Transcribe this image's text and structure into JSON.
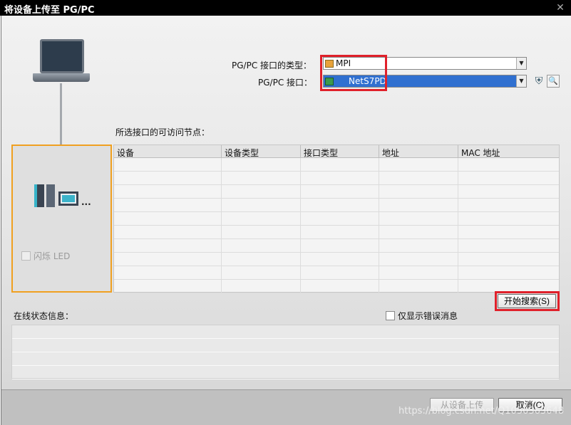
{
  "window": {
    "title": "将设备上传至 PG/PC"
  },
  "interface": {
    "type_label": "PG/PC 接口的类型：",
    "type_value": "MPI",
    "port_label": "PG/PC 接口：",
    "port_value": "NetS7PD"
  },
  "nodes": {
    "label": "所选接口的可访问节点：",
    "columns": [
      "设备",
      "设备类型",
      "接口类型",
      "地址",
      "MAC 地址"
    ],
    "rows": [
      [
        "",
        "",
        "",
        "",
        ""
      ],
      [
        "",
        "",
        "",
        "",
        ""
      ],
      [
        "",
        "",
        "",
        "",
        ""
      ],
      [
        "",
        "",
        "",
        "",
        ""
      ],
      [
        "",
        "",
        "",
        "",
        ""
      ],
      [
        "",
        "",
        "",
        "",
        ""
      ],
      [
        "",
        "",
        "",
        "",
        ""
      ],
      [
        "",
        "",
        "",
        "",
        ""
      ],
      [
        "",
        "",
        "",
        "",
        ""
      ],
      [
        "",
        "",
        "",
        "",
        ""
      ]
    ]
  },
  "device_panel": {
    "flash_led_label": "闪烁 LED",
    "dots": "..."
  },
  "search_button": "开始搜索(S)",
  "status": {
    "label": "在线状态信息：",
    "only_errors_label": "仅显示错误消息",
    "lines": [
      "",
      "",
      "",
      ""
    ]
  },
  "footer": {
    "upload_button": "从设备上传",
    "cancel_button": "取消(C)"
  },
  "watermark": "https://blog.csdn.net/Q1050363648",
  "colors": {
    "highlight": "#e0202a",
    "device_border": "#f0a020",
    "selection": "#3070d0"
  }
}
